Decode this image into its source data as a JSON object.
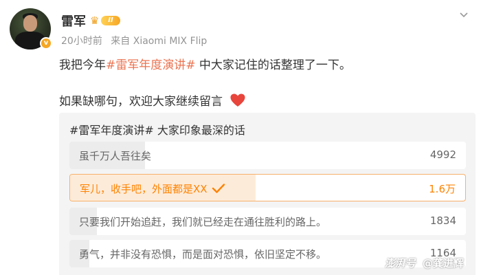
{
  "post": {
    "author": "雷军",
    "vip_level": "II",
    "time": "20小时前",
    "source": "来自 Xiaomi MIX Flip",
    "line1_prefix": "我把今年",
    "line1_topic": "#雷军年度演讲#",
    "line1_suffix": " 中大家记住的话整理了一下。",
    "line2": "如果缺哪句，欢迎大家继续留言"
  },
  "poll": {
    "title": "#雷军年度演讲# 大家印象最深的话",
    "options": [
      {
        "label": "虽千万人吾往矣",
        "count": "4992",
        "share": 0.19
      },
      {
        "label": "军儿，收手吧，外面都是XX",
        "count": "1.6万",
        "share": 0.47,
        "selected": true
      },
      {
        "label": "只要我们开始追赶，我们就已经走在通往胜利的路上。",
        "count": "1834",
        "share": 0.07
      },
      {
        "label": "勇气，并非没有恐惧，而是面对恐惧，依旧坚定不移。",
        "count": "1164",
        "share": 0.05
      }
    ]
  },
  "watermark": {
    "logo": "澎湃号",
    "handle": "@龚进辉"
  },
  "colors": {
    "accent": "#ff8200",
    "topic": "#eb7350",
    "heart": "#e8453c"
  }
}
